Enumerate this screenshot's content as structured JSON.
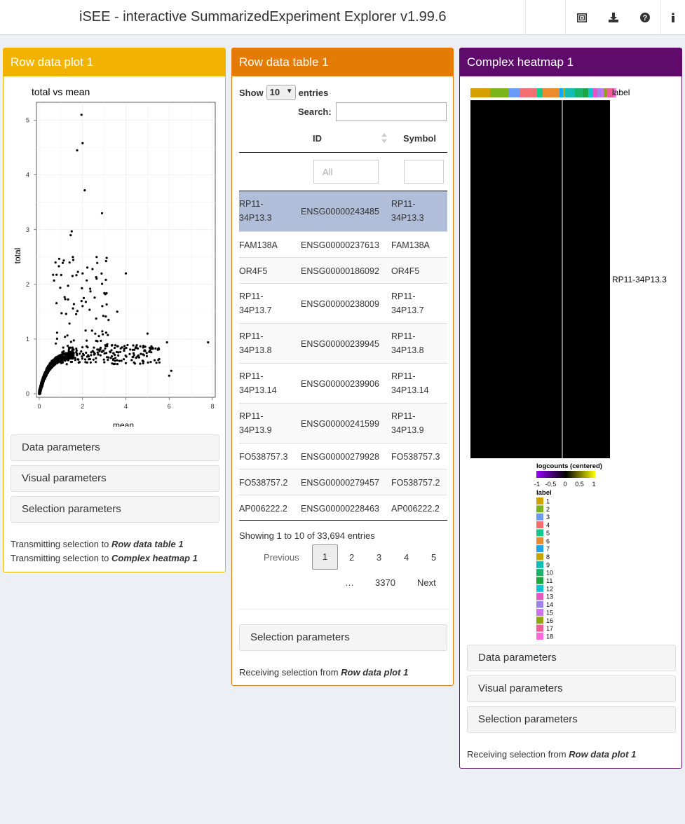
{
  "header": {
    "title": "iSEE - interactive SummarizedExperiment Explorer v1.99.6",
    "icons": [
      "screenshot-icon",
      "download-icon",
      "question-icon",
      "info-icon"
    ]
  },
  "panel1": {
    "title": "Row data plot 1",
    "plot": {
      "title": "total vs mean",
      "xlabel": "mean",
      "ylabel": "total",
      "xticks": [
        "0",
        "2",
        "4",
        "6",
        "8"
      ],
      "yticks": [
        "0",
        "1",
        "2",
        "3",
        "4",
        "5"
      ]
    },
    "sections": [
      "Data parameters",
      "Visual parameters",
      "Selection parameters"
    ],
    "transmit_prefix": "Transmitting selection to ",
    "transmit_targets": [
      "Row data table 1",
      "Complex heatmap 1"
    ]
  },
  "panel2": {
    "title": "Row data table 1",
    "show_label": "Show",
    "show_value": "10",
    "entries_label": "entries",
    "search_label": "Search:",
    "columns": [
      "ID",
      "Symbol"
    ],
    "filter_placeholder": "All",
    "rows": [
      {
        "name": "RP11-34P13.3",
        "id": "ENSG00000243485",
        "symbol": "RP11-34P13.3"
      },
      {
        "name": "FAM138A",
        "id": "ENSG00000237613",
        "symbol": "FAM138A"
      },
      {
        "name": "OR4F5",
        "id": "ENSG00000186092",
        "symbol": "OR4F5"
      },
      {
        "name": "RP11-34P13.7",
        "id": "ENSG00000238009",
        "symbol": "RP11-34P13.7"
      },
      {
        "name": "RP11-34P13.8",
        "id": "ENSG00000239945",
        "symbol": "RP11-34P13.8"
      },
      {
        "name": "RP11-34P13.14",
        "id": "ENSG00000239906",
        "symbol": "RP11-34P13.14"
      },
      {
        "name": "RP11-34P13.9",
        "id": "ENSG00000241599",
        "symbol": "RP11-34P13.9"
      },
      {
        "name": "FO538757.3",
        "id": "ENSG00000279928",
        "symbol": "FO538757.3"
      },
      {
        "name": "FO538757.2",
        "id": "ENSG00000279457",
        "symbol": "FO538757.2"
      },
      {
        "name": "AP006222.2",
        "id": "ENSG00000228463",
        "symbol": "AP006222.2"
      }
    ],
    "info": "Showing 1 to 10 of 33,694 entries",
    "pagination": {
      "previous": "Previous",
      "pages": [
        "1",
        "2",
        "3",
        "4",
        "5"
      ],
      "ellipsis": "…",
      "last": "3370",
      "next": "Next"
    },
    "sections": [
      "Selection parameters"
    ],
    "receive_prefix": "Receiving selection from ",
    "receive_source": "Row data plot 1"
  },
  "panel3": {
    "title": "Complex heatmap 1",
    "annotation_label": "label",
    "row_label": "RP11-34P13.3",
    "colorbar_title": "logcounts (centered)",
    "colorbar_ticks": [
      "-1",
      "-0.5",
      "0",
      "0.5",
      "1"
    ],
    "legend_title": "label",
    "legend": [
      {
        "label": "1",
        "color": "#d3a000"
      },
      {
        "label": "2",
        "color": "#7cb51a"
      },
      {
        "label": "3",
        "color": "#6b9bf5"
      },
      {
        "label": "4",
        "color": "#f36f6f"
      },
      {
        "label": "5",
        "color": "#15c98c"
      },
      {
        "label": "6",
        "color": "#ec8a2e"
      },
      {
        "label": "7",
        "color": "#1aa6f0"
      },
      {
        "label": "8",
        "color": "#c7a300"
      },
      {
        "label": "9",
        "color": "#12bcb5"
      },
      {
        "label": "10",
        "color": "#16b56a"
      },
      {
        "label": "11",
        "color": "#1ba542"
      },
      {
        "label": "12",
        "color": "#10c3d3"
      },
      {
        "label": "13",
        "color": "#e556c2"
      },
      {
        "label": "14",
        "color": "#9e83ec"
      },
      {
        "label": "15",
        "color": "#d070f0"
      },
      {
        "label": "16",
        "color": "#8fa512"
      },
      {
        "label": "17",
        "color": "#f25c9c"
      },
      {
        "label": "18",
        "color": "#ff66e0"
      }
    ],
    "sections": [
      "Data parameters",
      "Visual parameters",
      "Selection parameters"
    ],
    "receive_prefix": "Receiving selection from ",
    "receive_source": "Row data plot 1"
  },
  "colors": {
    "panel1": "#f2b300",
    "panel2": "#e37b05",
    "panel3": "#5e0b6b",
    "selected_row": "#b0bed9"
  }
}
